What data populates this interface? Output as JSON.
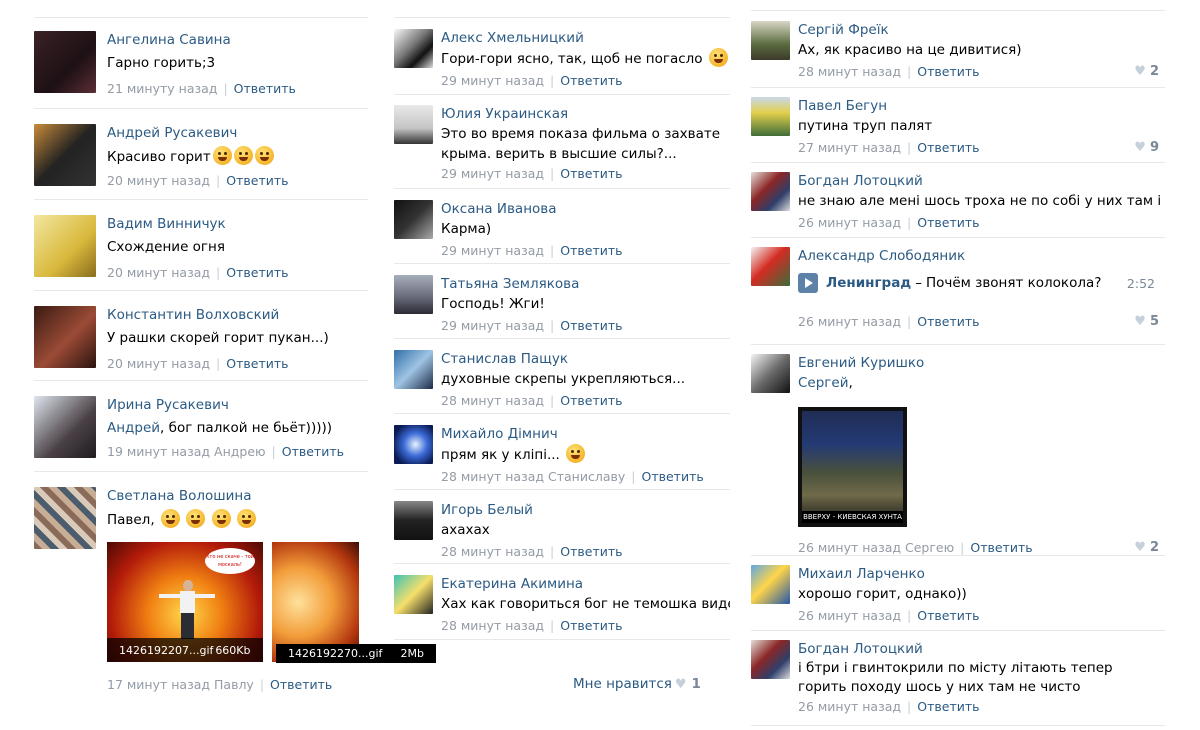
{
  "col1": {
    "comments": [
      {
        "author": "Ангелина Савина",
        "text": "Гарно горить;3",
        "time": "21 минуту назад",
        "reply": "Ответить",
        "avatar_icon": "avatar-dark"
      },
      {
        "author": "Андрей Русакевич",
        "text": "Красиво горит",
        "time": "20 минут назад",
        "reply": "Ответить",
        "avatar_icon": "avatar-man-car"
      },
      {
        "author": "Вадим Винничук",
        "text": "Схождение огня",
        "time": "20 минут назад",
        "reply": "Ответить",
        "avatar_icon": "avatar-man-yellow"
      },
      {
        "author": "Константин Волховский",
        "text": "У рашки скорей горит пукан...)",
        "time": "20 минут назад",
        "reply": "Ответить",
        "avatar_icon": "avatar-man-brown"
      },
      {
        "author": "Ирина Русакевич",
        "mention": "Андрей",
        "text": ", бог палкой не бьёт)))))",
        "time": "19 минут назад Андрею",
        "reply": "Ответить",
        "avatar_icon": "avatar-girl"
      },
      {
        "author": "Светлана Волошина",
        "text": "Павел,",
        "time": "17 минут назад Павлу",
        "reply": "Ответить",
        "avatar_icon": "avatar-mosaic",
        "attachments": [
          {
            "name": "1426192207...gif",
            "size": "660Kb",
            "bubble": "Хто не скаче - той москаль!"
          },
          {
            "name": "1426192270...gif",
            "size": "2Mb"
          }
        ]
      }
    ]
  },
  "col2": {
    "comments": [
      {
        "author": "Алекс Хмельницкий",
        "text": "Гори-гори ясно, так, щоб не погасло",
        "time": "29 минут назад",
        "reply": "Ответить",
        "avatar_icon": "avatar-bw"
      },
      {
        "author": "Юлия Украинская",
        "text": "Это во время показа фильма о захвате крыма. верить в высшие силы?...",
        "time": "29 минут назад",
        "reply": "Ответить",
        "avatar_icon": "avatar-umbrella"
      },
      {
        "author": "Оксана Иванова",
        "text": "Карма)",
        "time": "29 минут назад",
        "reply": "Ответить",
        "avatar_icon": "avatar-night"
      },
      {
        "author": "Татьяна Землякова",
        "text": "Господь! Жги!",
        "time": "29 минут назад",
        "reply": "Ответить",
        "avatar_icon": "avatar-mountain"
      },
      {
        "author": "Станислав Пащук",
        "text": "духовные скрепы укрепляються...",
        "time": "28 минут назад",
        "reply": "Ответить",
        "avatar_icon": "avatar-blue"
      },
      {
        "author": "Михайло Дімнич",
        "text": "прям як у клiпi...",
        "time": "28 минут назад Станиславу",
        "reply": "Ответить",
        "avatar_icon": "avatar-lightning"
      },
      {
        "author": "Игорь Белый",
        "text": "ахахах",
        "time": "28 минут назад",
        "reply": "Ответить",
        "avatar_icon": "avatar-car"
      },
      {
        "author": "Екатерина Акимина",
        "text": "Хах как говориться бог не темошка видет нем",
        "time": "28 минут назад",
        "reply": "Ответить",
        "avatar_icon": "avatar-popart"
      }
    ],
    "like": {
      "label": "Мне нравится",
      "count": "1"
    }
  },
  "col3": {
    "comments": [
      {
        "author": "Сергій Фреїк",
        "text": "Ах, як красиво на це дивитися)",
        "time": "28 минут назад",
        "reply": "Ответить",
        "likes": "2",
        "avatar_icon": "avatar-field"
      },
      {
        "author": "Павел Бегун",
        "text": "путина труп палят",
        "time": "27 минут назад",
        "reply": "Ответить",
        "likes": "9",
        "avatar_icon": "avatar-flag"
      },
      {
        "author": "Богдан Лотоцкий",
        "text": "не знаю але мені шось троха не по собі у них там і вв м",
        "time": "26 минут назад",
        "reply": "Ответить",
        "avatar_icon": "avatar-group"
      },
      {
        "author": "Александр Слободяник",
        "time": "26 минут назад",
        "reply": "Ответить",
        "likes": "5",
        "avatar_icon": "avatar-santa",
        "audio": {
          "artist": "Ленинград",
          "title": "Почём звонят колокола?",
          "duration": "2:52"
        }
      },
      {
        "author": "Евгений Куришко",
        "mention": "Сергей",
        "text": ",",
        "time": "26 минут назад Сергею",
        "reply": "Ответить",
        "likes": "2",
        "avatar_icon": "avatar-dog",
        "photo_caption": "ВВЕРХУ - КИЕВСКАЯ ХУНТА"
      },
      {
        "author": "Михаил Ларченко",
        "text": "хорошо горит, однако))",
        "time": "26 минут назад",
        "reply": "Ответить",
        "avatar_icon": "avatar-rally"
      },
      {
        "author": "Богдан Лотоцкий",
        "text": "і бтри і гвинтокрили по місту літають тепер горить походу шось у них там не чисто",
        "time": "26 минут назад",
        "reply": "Ответить",
        "avatar_icon": "avatar-group"
      }
    ]
  }
}
